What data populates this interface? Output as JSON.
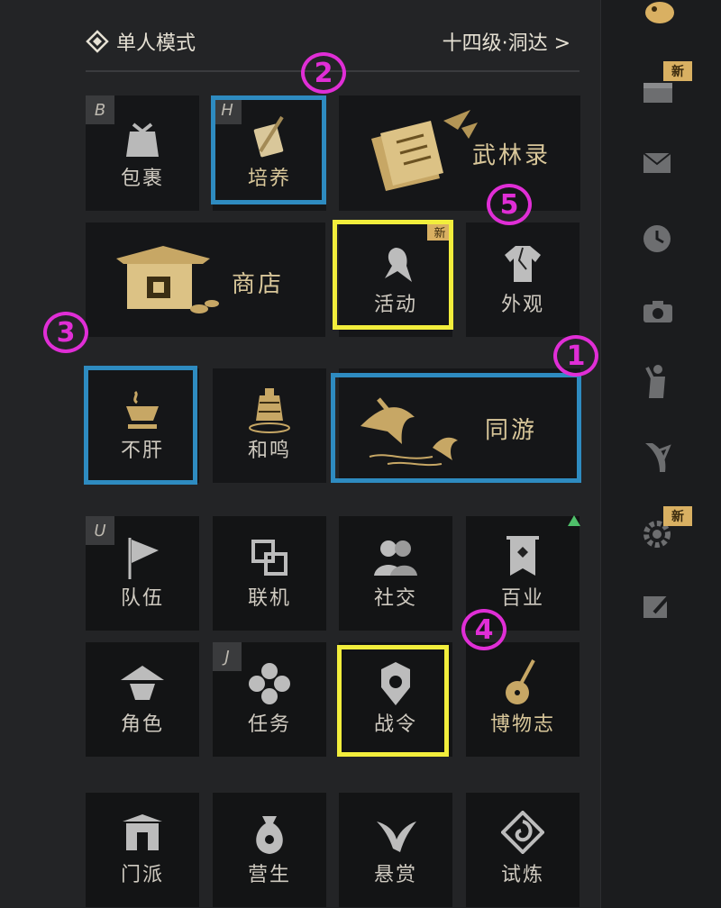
{
  "header": {
    "mode_icon": "diamond-emblem-icon",
    "mode_label": "单人模式",
    "level_label": "十四级·洞达 >"
  },
  "tiles": {
    "bag": {
      "label": "包裹",
      "hotkey": "B",
      "icon": "bundle-icon"
    },
    "cultivate": {
      "label": "培养",
      "hotkey": "H",
      "icon": "sword-book-icon"
    },
    "wulin_record": {
      "label": "武林录",
      "icon": "scrolls-icon"
    },
    "shop": {
      "label": "商店",
      "icon": "shop-stall-icon"
    },
    "activity": {
      "label": "活动",
      "badge": "新",
      "icon": "bird-icon"
    },
    "appearance": {
      "label": "外观",
      "icon": "robe-icon"
    },
    "buguan": {
      "label": "不肝",
      "icon": "tea-cup-icon"
    },
    "heming": {
      "label": "和鸣",
      "icon": "bell-icon"
    },
    "tongyou": {
      "label": "同游",
      "icon": "cranes-icon"
    },
    "team": {
      "label": "队伍",
      "hotkey": "U",
      "icon": "flag-icon"
    },
    "online": {
      "label": "联机",
      "icon": "link-icon"
    },
    "social": {
      "label": "社交",
      "icon": "people-icon"
    },
    "professions": {
      "label": "百业",
      "icon": "banner-icon"
    },
    "character": {
      "label": "角色",
      "icon": "hat-icon"
    },
    "quests": {
      "label": "任务",
      "hotkey": "J",
      "icon": "quatrefoil-icon"
    },
    "battle_pass": {
      "label": "战令",
      "icon": "shield-emblem-icon"
    },
    "museum": {
      "label": "博物志",
      "icon": "pipa-icon"
    },
    "sect": {
      "label": "门派",
      "icon": "gate-icon"
    },
    "livelihood": {
      "label": "营生",
      "icon": "money-bag-icon"
    },
    "bounty": {
      "label": "悬赏",
      "icon": "swallow-icon"
    },
    "trial": {
      "label": "试炼",
      "icon": "vortex-icon"
    }
  },
  "annotations": {
    "n1": "1",
    "n2": "2",
    "n3": "3",
    "n4": "4",
    "n5": "5",
    "blue": "#2e8bc0",
    "yellow": "#f2ee3c",
    "magenta": "#e02ed6"
  },
  "rail": {
    "items": [
      {
        "icon": "bird-avatar-icon"
      },
      {
        "icon": "calendar-icon",
        "badge": "新"
      },
      {
        "icon": "mail-icon"
      },
      {
        "icon": "clock-icon"
      },
      {
        "icon": "camera-icon"
      },
      {
        "icon": "figure-icon"
      },
      {
        "icon": "feather-icon"
      },
      {
        "icon": "gear-icon",
        "badge": "新"
      },
      {
        "icon": "edit-icon"
      }
    ]
  },
  "colors": {
    "gold": "#d9c79a",
    "panel": "#232426",
    "tile": "#151618"
  }
}
